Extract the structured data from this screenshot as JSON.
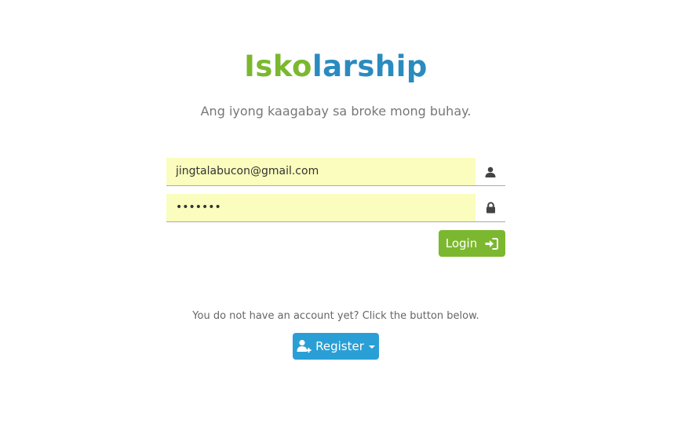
{
  "brand": {
    "part1": "Isko",
    "part2": "larship",
    "colors": {
      "green": "#7cb82f",
      "blue": "#2a8bbf"
    }
  },
  "tagline": "Ang iyong kaagabay sa broke mong buhay.",
  "login_form": {
    "email": {
      "value": "jingtalabucon@gmail.com",
      "icon": "user-icon"
    },
    "password": {
      "value": "•••••••",
      "icon": "lock-icon"
    },
    "login_button": {
      "label": "Login",
      "icon": "sign-in-icon",
      "color": "#7cb82f"
    }
  },
  "register": {
    "prompt": "You do not have an account yet? Click the button below.",
    "button": {
      "label": "Register",
      "icon": "add-user-icon",
      "color": "#2a9fd6"
    }
  }
}
